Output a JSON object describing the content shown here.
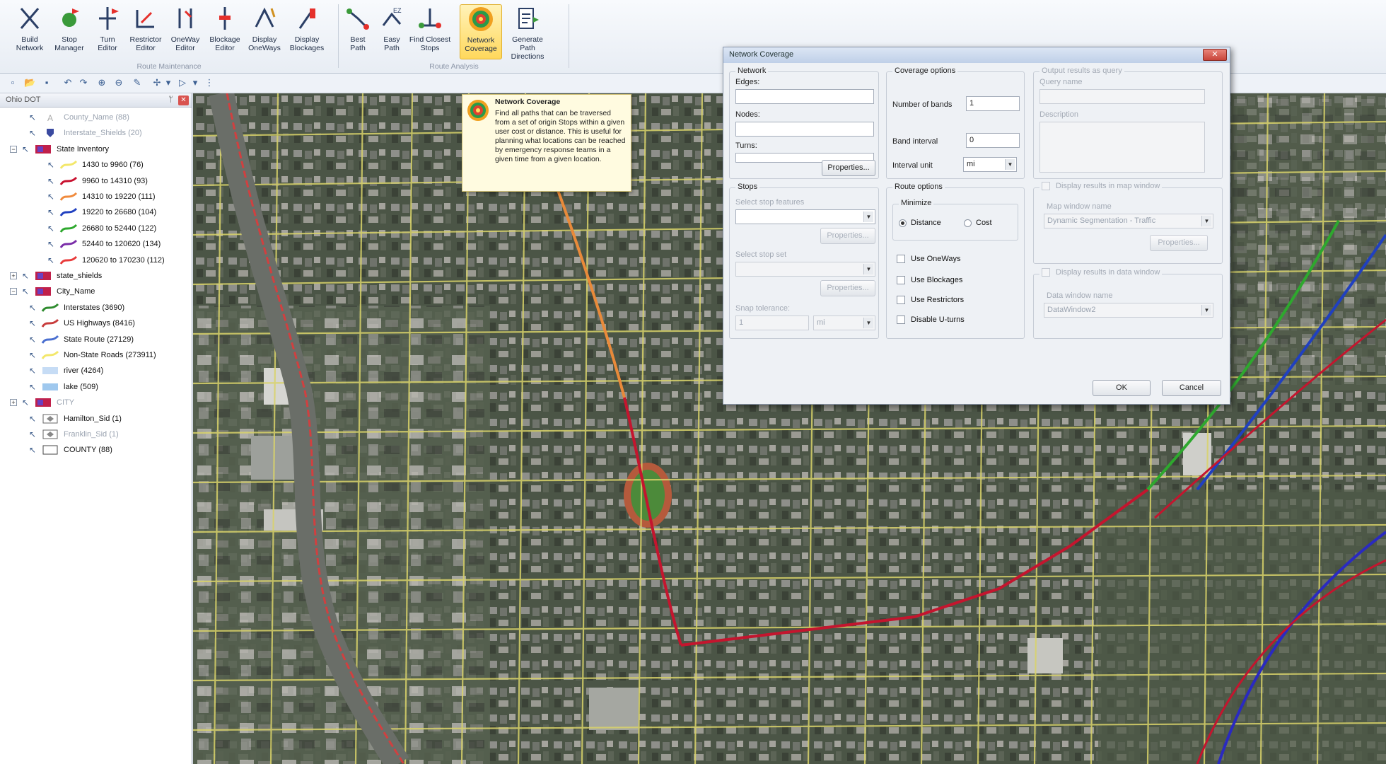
{
  "ribbon": {
    "group_route_maintenance": "Route Maintenance",
    "group_route_analysis": "Route Analysis",
    "buttons": [
      {
        "l1": "Build",
        "l2": "Network"
      },
      {
        "l1": "Stop",
        "l2": "Manager"
      },
      {
        "l1": "Turn",
        "l2": "Editor"
      },
      {
        "l1": "Restrictor",
        "l2": "Editor"
      },
      {
        "l1": "OneWay",
        "l2": "Editor"
      },
      {
        "l1": "Blockage",
        "l2": "Editor"
      },
      {
        "l1": "Display",
        "l2": "OneWays"
      },
      {
        "l1": "Display",
        "l2": "Blockages"
      },
      {
        "l1": "Best",
        "l2": "Path"
      },
      {
        "l1": "Easy",
        "l2": "Path"
      },
      {
        "l1": "Find Closest",
        "l2": "Stops"
      },
      {
        "l1": "Network",
        "l2": "Coverage"
      },
      {
        "l1": "Generate Path",
        "l2": "Directions"
      }
    ],
    "active_color": "#ffd85c"
  },
  "layers": {
    "title": "Ohio DOT",
    "items": [
      {
        "label": "County_Name (88)",
        "dim": true
      },
      {
        "label": "Interstate_Shields (20)",
        "dim": true
      },
      {
        "label": "State Inventory",
        "dim": false
      },
      {
        "label": "1430 to 9960 (76)",
        "color": "#f3e76a"
      },
      {
        "label": "9960 to 14310 (93)",
        "color": "#c8102e"
      },
      {
        "label": "14310 to 19220 (111)",
        "color": "#f08a3c"
      },
      {
        "label": "19220 to 26680 (104)",
        "color": "#2040c0"
      },
      {
        "label": "26680 to 52440 (122)",
        "color": "#2ea82e"
      },
      {
        "label": "52440 to 120620 (134)",
        "color": "#7a2ca8"
      },
      {
        "label": "120620 to 170230 (112)",
        "color": "#e83a3a"
      },
      {
        "label": "state_shields",
        "dim": false
      },
      {
        "label": "City_Name",
        "dim": false
      },
      {
        "label": "Interstates (3690)",
        "color": "#2e8b2e"
      },
      {
        "label": "US Highways (8416)",
        "color": "#c83c3c"
      },
      {
        "label": "State Route (27129)",
        "color": "#4a6fd0"
      },
      {
        "label": "Non-State Roads (273911)",
        "color": "#f3e76a"
      },
      {
        "label": "river (4264)",
        "color": "#c6dcf5"
      },
      {
        "label": "lake (509)",
        "color": "#9fc8ee"
      },
      {
        "label": "CITY",
        "dim": true
      },
      {
        "label": "Hamilton_Sid (1)",
        "dim": false
      },
      {
        "label": "Franklin_Sid (1)",
        "dim": true
      },
      {
        "label": "COUNTY (88)",
        "dim": false
      }
    ]
  },
  "tooltip": {
    "title": "Network Coverage",
    "body": "Find all paths that can be traversed from a set of origin Stops within a given user cost or distance. This is useful for planning what locations can be reached by emergency response teams in a given time from a given location."
  },
  "dialog": {
    "title": "Network Coverage",
    "network": {
      "legend": "Network",
      "edges_label": "Edges:",
      "nodes_label": "Nodes:",
      "turns_label": "Turns:",
      "properties": "Properties..."
    },
    "coverage": {
      "legend": "Coverage options",
      "bands_label": "Number of bands",
      "bands_value": "1",
      "interval_label": "Band interval",
      "interval_value": "0",
      "unit_label": "Interval unit",
      "unit_value": "mi"
    },
    "output": {
      "legend": "Output results as query",
      "query_label": "Query name",
      "desc_label": "Description"
    },
    "stops": {
      "legend": "Stops",
      "features_label": "Select stop features",
      "properties1": "Properties...",
      "set_label": "Select stop set",
      "properties2": "Properties...",
      "snap_label": "Snap tolerance:",
      "snap_value": "1",
      "snap_unit": "mi"
    },
    "route": {
      "legend": "Route options",
      "minimize": "Minimize",
      "distance": "Distance",
      "cost": "Cost",
      "use_oneways": "Use OneWays",
      "use_blockages": "Use Blockages",
      "use_restrictors": "Use Restrictors",
      "disable_uturns": "Disable U-turns"
    },
    "map_window": {
      "legend": "Display results in map window",
      "name_label": "Map window name",
      "name_value": "Dynamic Segmentation - Traffic",
      "properties": "Properties..."
    },
    "data_window": {
      "legend": "Display results in data window",
      "name_label": "Data window name",
      "name_value": "DataWindow2"
    },
    "ok": "OK",
    "cancel": "Cancel"
  }
}
